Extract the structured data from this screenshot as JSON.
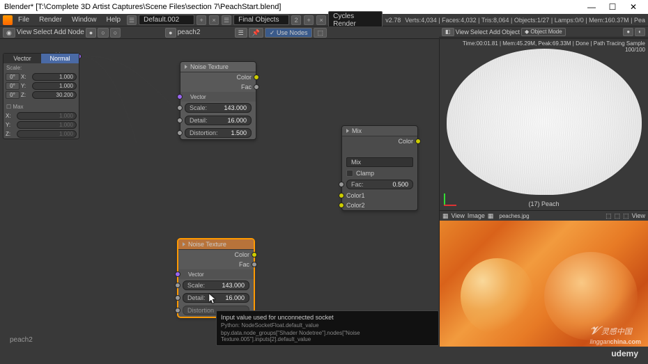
{
  "app": {
    "title": "Blender* [T:\\Complete 3D Artist Captures\\Scene Files\\section 7\\PeachStart.blend]"
  },
  "win_controls": {
    "min": "—",
    "max": "☐",
    "close": "✕"
  },
  "topmenu": {
    "items": [
      "File",
      "Render",
      "Window",
      "Help"
    ],
    "layout_field": "Default.002",
    "scene_field": "Final Objects",
    "engine": "Cycles Render",
    "version": "v2.78",
    "stats": "Verts:4,034 | Faces:4,032 | Tris:8,064 | Objects:1/27 | Lamps:0/0 | Mem:160.37M | Pea"
  },
  "nodebar": {
    "items": [
      "View",
      "Select",
      "Add",
      "Node"
    ],
    "material_field": "peach2",
    "use_nodes": "Use Nodes"
  },
  "viewhead": {
    "items": [
      "View",
      "Select",
      "Add",
      "Object"
    ],
    "mode": "Object Mode"
  },
  "hud": "Time:00:01.81 | Mem:45.29M, Peak:69.33M | Done | Path Tracing Sample 100/100",
  "viewport": {
    "object_label": "(17) Peach"
  },
  "imgbar": {
    "items": [
      "View",
      "Image"
    ],
    "file": "peaches.jpg",
    "view_btn": "View"
  },
  "side": {
    "vector_label": "Vector",
    "tabs": {
      "vector": "Vector",
      "normal": "Normal"
    },
    "scale_label": "Scale:",
    "rows": [
      {
        "btn": "0°",
        "axis": "X:",
        "val": "1.000"
      },
      {
        "btn": "0°",
        "axis": "Y:",
        "val": "1.000"
      },
      {
        "btn": "0°",
        "axis": "Z:",
        "val": "30.200"
      }
    ],
    "max_label": "Max",
    "max_rows": [
      {
        "axis": "X:",
        "val": "1.000"
      },
      {
        "axis": "Y:",
        "val": "1.000"
      },
      {
        "axis": "Z:",
        "val": "1.000"
      }
    ]
  },
  "nodes": {
    "noise1": {
      "title": "Noise Texture",
      "color": "Color",
      "fac": "Fac",
      "vector": "Vector",
      "scale_lbl": "Scale:",
      "scale_val": "143.000",
      "detail_lbl": "Detail:",
      "detail_val": "16.000",
      "dist_lbl": "Distortion:",
      "dist_val": "1.500"
    },
    "noise2": {
      "title": "Noise Texture",
      "color": "Color",
      "fac": "Fac",
      "vector": "Vector",
      "scale_lbl": "Scale:",
      "scale_val": "143.000",
      "detail_lbl": "Detail:",
      "detail_val": "16.000",
      "dist_lbl": "Distortion"
    },
    "mix": {
      "title": "Mix",
      "color": "Color",
      "mode": "Mix",
      "clamp": "Clamp",
      "fac_lbl": "Fac:",
      "fac_val": "0.500",
      "color1": "Color1",
      "color2": "Color2"
    }
  },
  "tooltip": {
    "t1": "Input value used for unconnected socket",
    "t2": "Python: NodeSocketFloat.default_value",
    "t3": "bpy.data.node_groups[\"Shader Nodetree\"].nodes[\"Noise Texture.005\"].inputs[2].default_value"
  },
  "bottom_label": "peach2",
  "watermark": {
    "cn": "灵感中国",
    "en": "linggan",
    "dom": "china.com"
  },
  "udemy": "udemy"
}
